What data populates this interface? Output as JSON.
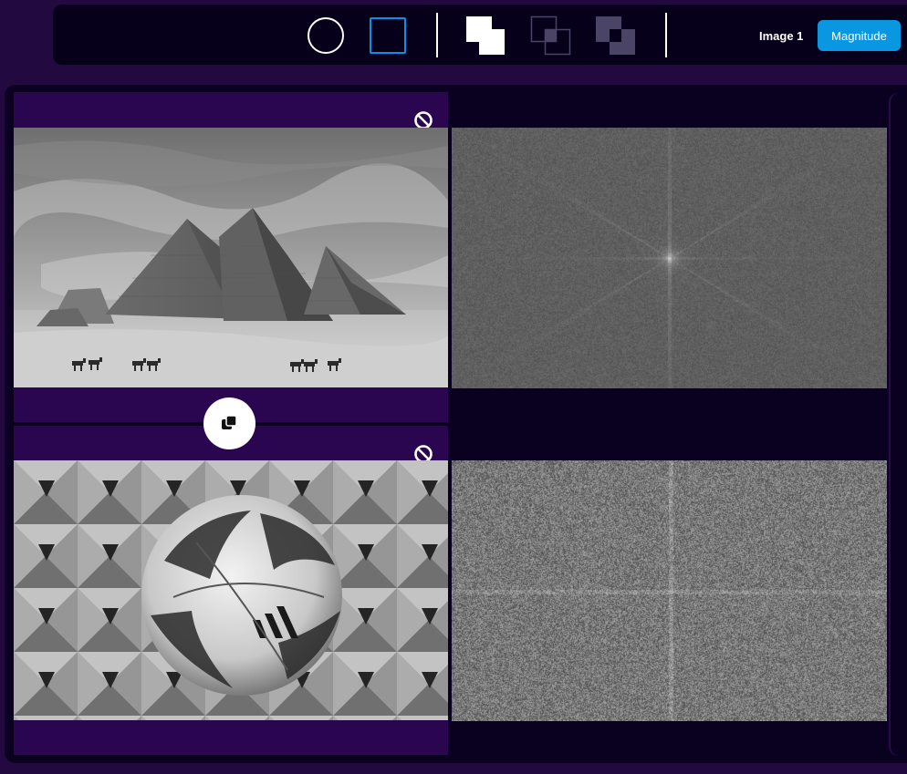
{
  "toolbar": {
    "shape_tools": [
      {
        "name": "circle-select-icon",
        "selected": false
      },
      {
        "name": "rectangle-select-icon",
        "selected": true
      }
    ],
    "region_ops": [
      "union-icon",
      "intersect-icon",
      "subtract-icon"
    ],
    "image_label": "Image 1",
    "component_button_label": "Magnitude",
    "colors": {
      "accent": "#0a97e1",
      "toolbar_bg": "#07001a",
      "page_bg": "#22093f",
      "card_bg": "#2a0650"
    }
  },
  "images": [
    {
      "slot": 1,
      "content": "pyramids-photo",
      "disable_icon": "no-entry-icon",
      "transform_view": "fft-magnitude-star"
    },
    {
      "slot": 2,
      "content": "football-photo",
      "disable_icon": "no-entry-icon",
      "transform_view": "fft-noise-cross"
    }
  ],
  "swap_button_icon": "copy-swap-icon"
}
